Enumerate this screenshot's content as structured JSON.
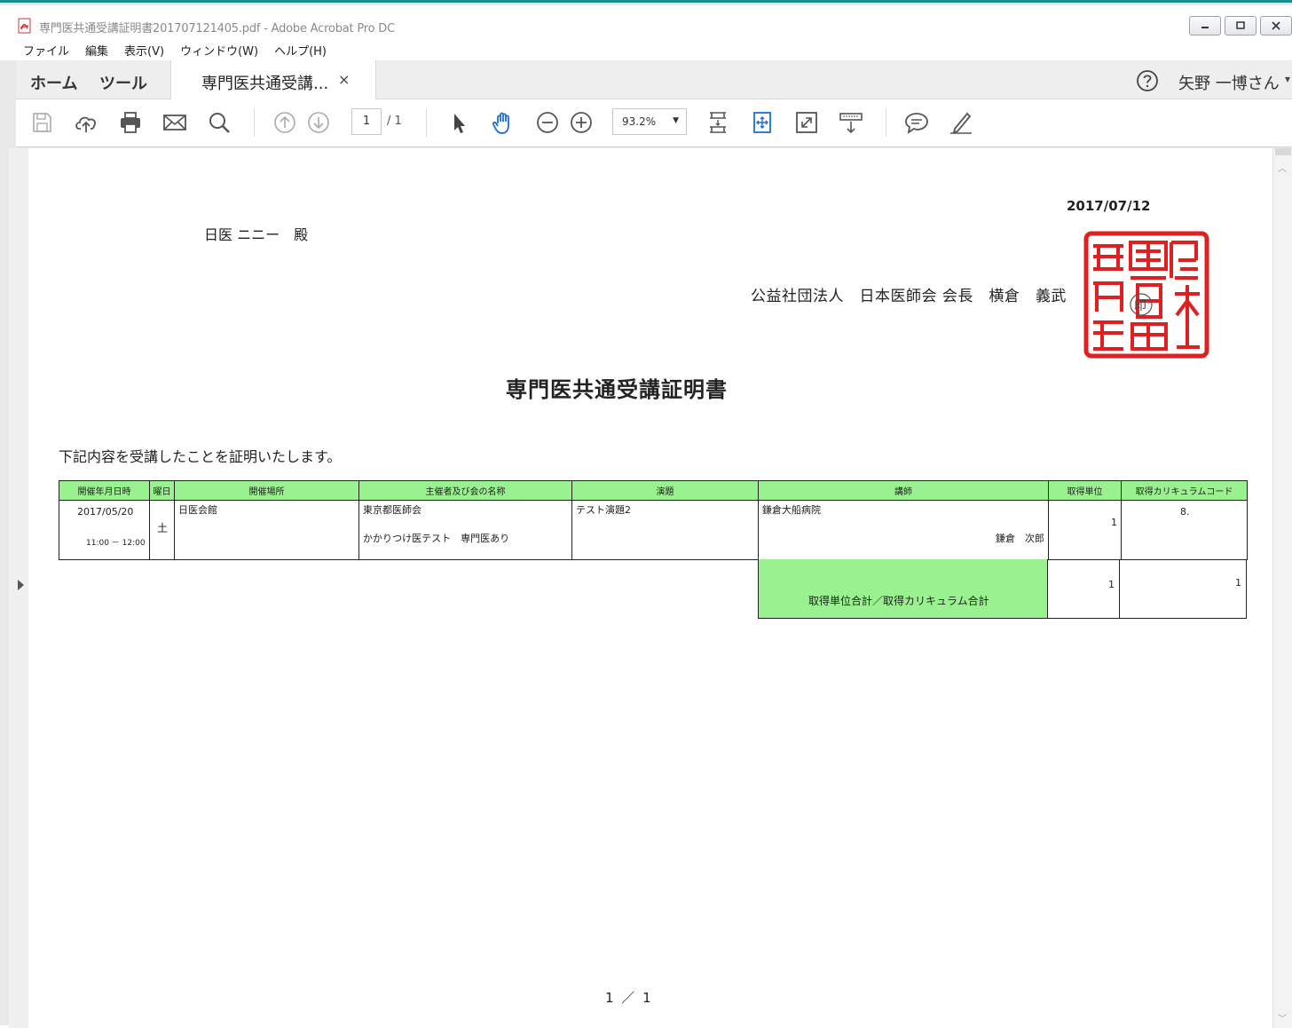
{
  "window": {
    "title": "専門医共通受講証明書201707121405.pdf - Adobe Acrobat Pro DC"
  },
  "menu": [
    "ファイル",
    "編集",
    "表示(V)",
    "ウィンドウ(W)",
    "ヘルプ(H)"
  ],
  "tabs": {
    "home": "ホーム",
    "tools": "ツール",
    "document": "専門医共通受講...",
    "close": "×"
  },
  "user": {
    "name": "矢野 一博さん"
  },
  "toolbar": {
    "page_current": "1",
    "page_total": "/ 1",
    "zoom": "93.2%"
  },
  "document": {
    "date": "2017/07/12",
    "recipient": "日医 ニニー　殿",
    "issuer": "公益社団法人　日本医師会 会長　横倉　義武",
    "seal_mark": "印",
    "title": "専門医共通受講証明書",
    "intro": "下記内容を受講したことを証明いたします。",
    "table": {
      "headers": [
        "開催年月日時",
        "曜日",
        "開催場所",
        "主催者及び会の名称",
        "演題",
        "講師",
        "取得単位",
        "取得カリキュラムコード"
      ],
      "rows": [
        {
          "date": "2017/05/20",
          "time": "11:00 － 12:00",
          "weekday": "土",
          "venue": "日医会館",
          "organizer": "東京都医師会",
          "meeting_name": "かかりつけ医テスト　専門医あり",
          "topic": "テスト演題2",
          "lecturer_affiliation": "鎌倉大船病院",
          "lecturer_name": "鎌倉　次郎",
          "units": "1",
          "curriculum_code": "8."
        }
      ],
      "total_label": "取得単位合計／取得カリキュラム合計",
      "total_units": "1",
      "total_curriculum": "1"
    },
    "page_number": "1 ／ 1"
  }
}
